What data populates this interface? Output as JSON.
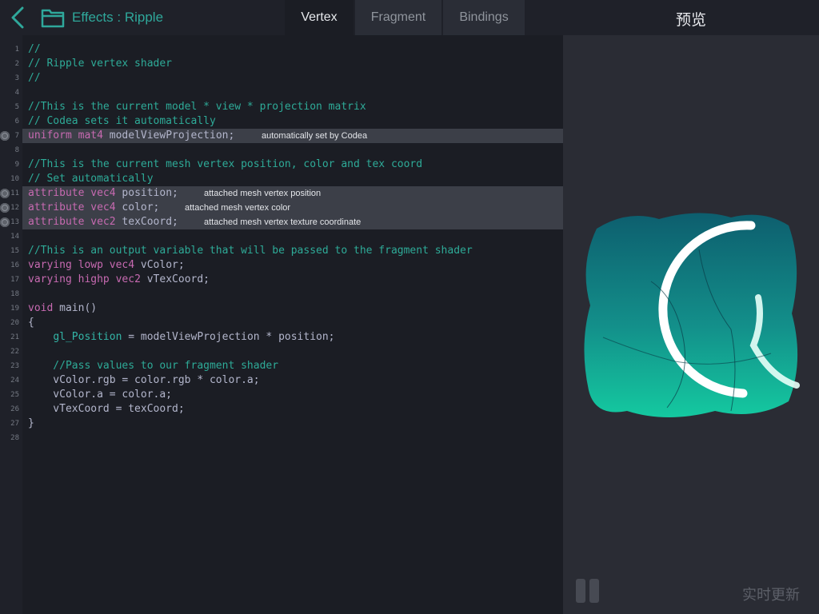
{
  "header": {
    "title": "Effects : Ripple",
    "tabs": [
      {
        "label": "Vertex",
        "active": true
      },
      {
        "label": "Fragment",
        "active": false
      },
      {
        "label": "Bindings",
        "active": false
      }
    ]
  },
  "preview": {
    "title": "预览",
    "live_update_label": "实时更新"
  },
  "colors": {
    "keyword": "#c76ab1",
    "comment": "#2eab98",
    "identifier": "#8f95c4",
    "teal_accent": "#2fa89b"
  },
  "editor": {
    "lines": [
      {
        "num": "1",
        "text": "//"
      },
      {
        "num": "2",
        "text": "// Ripple vertex shader"
      },
      {
        "num": "3",
        "text": "//"
      },
      {
        "num": "4",
        "text": ""
      },
      {
        "num": "5",
        "text": "//This is the current model * view * projection matrix"
      },
      {
        "num": "6",
        "text": "// Codea sets it automatically"
      },
      {
        "num": "7",
        "text": "uniform mat4 modelViewProjection;",
        "note": "automatically set by Codea"
      },
      {
        "num": "8",
        "text": ""
      },
      {
        "num": "9",
        "text": "//This is the current mesh vertex position, color and tex coord"
      },
      {
        "num": "10",
        "text": "// Set automatically"
      },
      {
        "num": "11",
        "text": "attribute vec4 position;",
        "note": "attached mesh vertex position"
      },
      {
        "num": "12",
        "text": "attribute vec4 color;",
        "note": "attached mesh vertex color"
      },
      {
        "num": "13",
        "text": "attribute vec2 texCoord;",
        "note": "attached mesh vertex texture coordinate"
      },
      {
        "num": "14",
        "text": ""
      },
      {
        "num": "15",
        "text": "//This is an output variable that will be passed to the fragment shader"
      },
      {
        "num": "16",
        "text": "varying lowp vec4 vColor;"
      },
      {
        "num": "17",
        "text": "varying highp vec2 vTexCoord;"
      },
      {
        "num": "18",
        "text": ""
      },
      {
        "num": "19",
        "text": "void main()"
      },
      {
        "num": "20",
        "text": "{"
      },
      {
        "num": "21",
        "text": "    gl_Position = modelViewProjection * position;"
      },
      {
        "num": "22",
        "text": ""
      },
      {
        "num": "23",
        "text": "    //Pass values to our fragment shader"
      },
      {
        "num": "24",
        "text": "    vColor.rgb = color.rgb * color.a;"
      },
      {
        "num": "25",
        "text": "    vColor.a = color.a;"
      },
      {
        "num": "26",
        "text": "    vTexCoord = texCoord;"
      },
      {
        "num": "27",
        "text": "}"
      },
      {
        "num": "28",
        "text": ""
      }
    ]
  }
}
